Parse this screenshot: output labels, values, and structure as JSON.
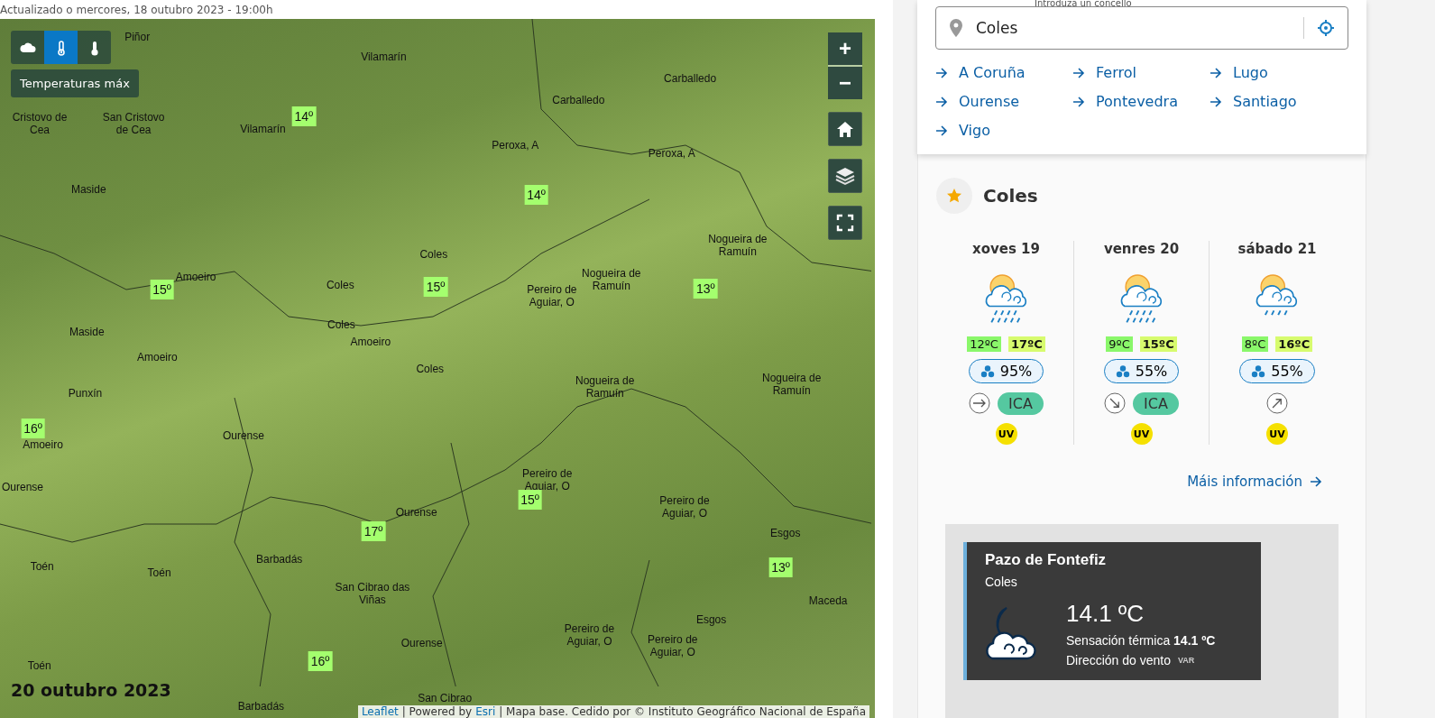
{
  "header": {
    "updated": "Actualizado o mercores, 18 outubro 2023 - 19:00h"
  },
  "map": {
    "layers": [
      {
        "kind": "cloud",
        "selected": false
      },
      {
        "kind": "thermometer",
        "selected": true
      },
      {
        "kind": "thermometer-low",
        "selected": false
      }
    ],
    "layer_label": "Temperaturas máx",
    "zoom_in": "+",
    "zoom_out": "−",
    "date": "20 outubro 2023",
    "places": [
      "Piñor",
      "Vilamarín",
      "Carballedo",
      "Carballedo",
      "Cristovo de Cea",
      "San Cristovo de Cea",
      "Vilamarín",
      "Peroxa, A",
      "Peroxa, A",
      "Maside",
      "Coles",
      "Amoeiro",
      "Coles",
      "Nogueira de Ramuín",
      "Pereiro de Aguiar, O",
      "Nogueira de Ramuín",
      "Maside",
      "Coles",
      "Amoeiro",
      "Amoeiro",
      "Coles",
      "Punxín",
      "Nogueira de Ramuín",
      "Nogueira de Ramuín",
      "Ourense",
      "Amoeiro",
      "Ourense",
      "Pereiro de Aguiar, O",
      "Ourense",
      "Pereiro de Aguiar, O",
      "Esgos",
      "Barbadás",
      "Toén",
      "Toén",
      "San Cibrao das Viñas",
      "Maceda",
      "Esgos",
      "Ourense",
      "Pereiro de Aguiar, O",
      "Pereiro de Aguiar, O",
      "Toén",
      "San Cibrao",
      "Barbadás"
    ],
    "temperatures": [
      "14º",
      "14º",
      "15º",
      "15º",
      "13º",
      "16º",
      "15º",
      "17º",
      "13º",
      "16º"
    ],
    "attribution": {
      "leaflet": "Leaflet",
      "powered": "| Powered by",
      "esri": "Esri",
      "rest": "| Mapa base. Cedido por © Instituto Geográfico Nacional de España"
    }
  },
  "search": {
    "label": "Introduza un concello",
    "value": "Coles"
  },
  "cities": [
    "A Coruña",
    "Ferrol",
    "Lugo",
    "Ourense",
    "Pontevedra",
    "Santiago",
    "Vigo"
  ],
  "forecast": {
    "place": "Coles",
    "favorite": true,
    "more": "Máis información",
    "days": [
      {
        "day": "xoves 19",
        "sky": {
          "kind": "heavy-rain"
        },
        "min": "12ºC",
        "max": "17ºC",
        "rain": "95%",
        "wind": {
          "kind": "E"
        },
        "ica": "ICA",
        "uv": "UV"
      },
      {
        "day": "venres 20",
        "sky": {
          "kind": "heavy-rain"
        },
        "min": "9ºC",
        "max": "15ºC",
        "rain": "55%",
        "wind": {
          "kind": "SE"
        },
        "ica": "ICA",
        "uv": "UV"
      },
      {
        "day": "sábado 21",
        "sky": {
          "kind": "light-rain"
        },
        "min": "8ºC",
        "max": "16ºC",
        "rain": "55%",
        "wind": {
          "kind": "NE"
        },
        "uv": "UV"
      }
    ]
  },
  "station": {
    "name": "Pazo de Fontefiz",
    "municipality": "Coles",
    "sky": {
      "kind": "night-cloud"
    },
    "temp": "14.1 ºC",
    "feels_label": "Sensación térmica",
    "feels": "14.1 ºC",
    "wind_label": "Dirección do vento",
    "wind": "VAR"
  }
}
